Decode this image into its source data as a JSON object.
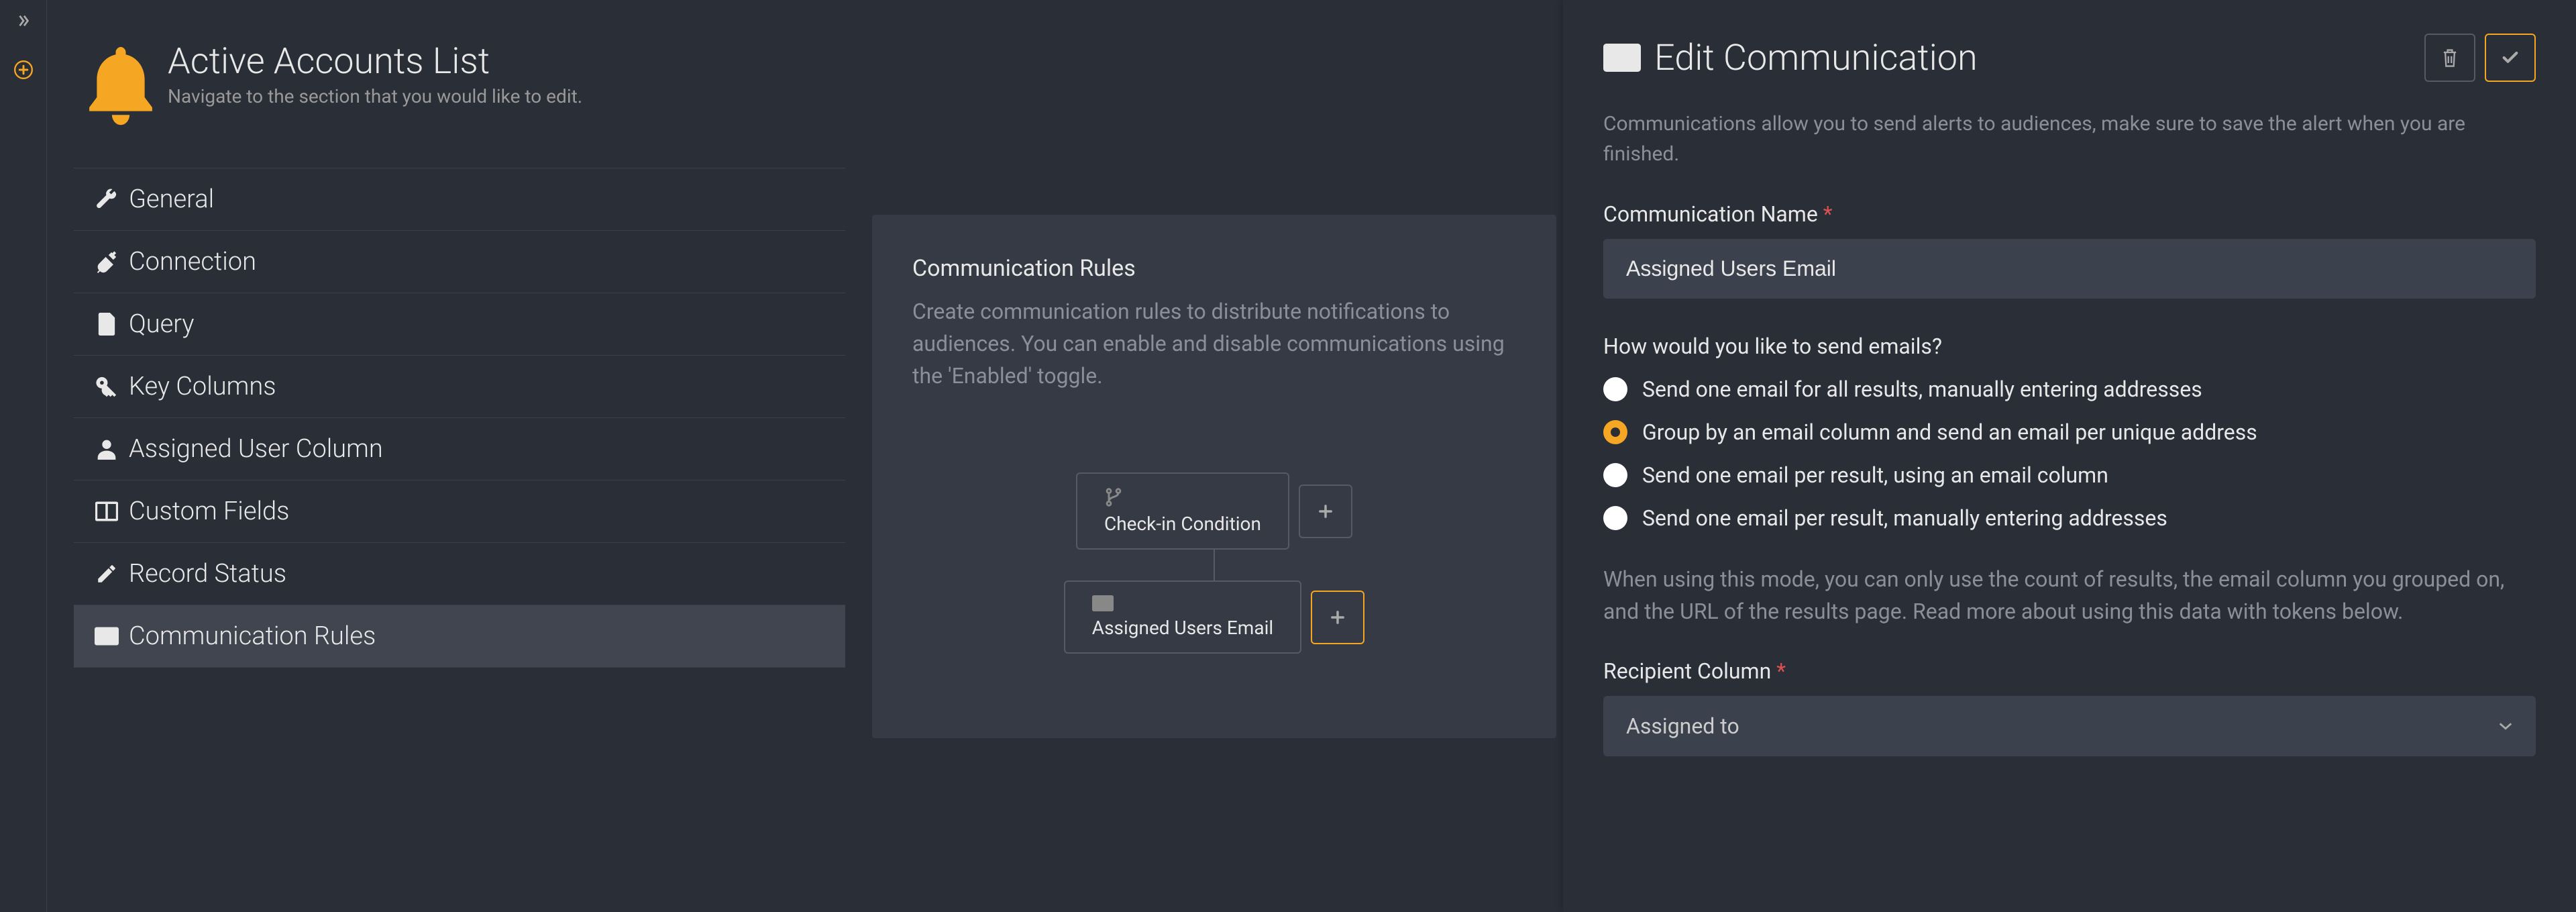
{
  "header": {
    "title": "Active Accounts List",
    "subtitle": "Navigate to the section that you would like to edit."
  },
  "nav": {
    "items": [
      {
        "id": "general",
        "label": "General",
        "icon": "wrench",
        "active": false
      },
      {
        "id": "connection",
        "label": "Connection",
        "icon": "plug",
        "active": false
      },
      {
        "id": "query",
        "label": "Query",
        "icon": "file",
        "active": false
      },
      {
        "id": "key_columns",
        "label": "Key Columns",
        "icon": "key",
        "active": false
      },
      {
        "id": "assigned_user_column",
        "label": "Assigned User Column",
        "icon": "user",
        "active": false
      },
      {
        "id": "custom_fields",
        "label": "Custom Fields",
        "icon": "columns",
        "active": false
      },
      {
        "id": "record_status",
        "label": "Record Status",
        "icon": "edit",
        "active": false
      },
      {
        "id": "communication_rules",
        "label": "Communication Rules",
        "icon": "envelope",
        "active": true
      }
    ]
  },
  "rules": {
    "title": "Communication Rules",
    "description": "Create communication rules to distribute notifications to audiences. You can enable and disable communications using the 'Enabled' toggle.",
    "nodes": {
      "root": {
        "label": "Check-in Condition"
      },
      "child": {
        "label": "Assigned Users Email"
      }
    }
  },
  "panel": {
    "title": "Edit Communication",
    "description": "Communications allow you to send alerts to audiences, make sure to save the alert when you are finished.",
    "comm_name_label": "Communication Name",
    "comm_name_value": "Assigned Users Email",
    "send_mode_label": "How would you like to send emails?",
    "send_modes": [
      {
        "label": "Send one email for all results, manually entering addresses",
        "selected": false
      },
      {
        "label": "Group by an email column and send an email per unique address",
        "selected": true
      },
      {
        "label": "Send one email per result, using an email column",
        "selected": false
      },
      {
        "label": "Send one email per result, manually entering addresses",
        "selected": false
      }
    ],
    "mode_description": "When using this mode, you can only use the count of results, the email column you grouped on, and the URL of the results page. Read more about using this data with tokens below.",
    "recipient_label": "Recipient Column",
    "recipient_value": "Assigned to"
  },
  "colors": {
    "accent": "#f5a623",
    "bg": "#2a2e37",
    "card": "#353a44",
    "input": "#3c424d",
    "muted": "#8a8f99",
    "danger": "#e05050"
  }
}
